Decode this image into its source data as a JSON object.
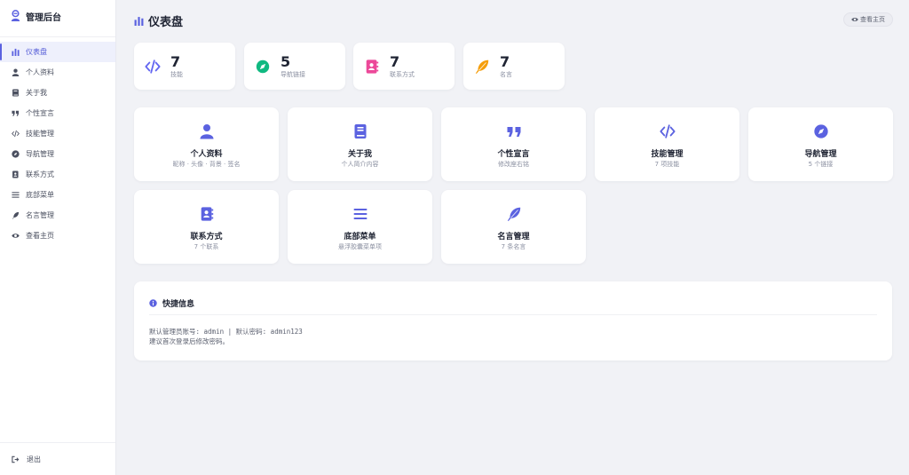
{
  "brand": {
    "title": "管理后台"
  },
  "sidebar": {
    "items": [
      {
        "label": "仪表盘",
        "icon": "chart-bar-icon",
        "active": true
      },
      {
        "label": "个人资料",
        "icon": "user-icon"
      },
      {
        "label": "关于我",
        "icon": "book-icon"
      },
      {
        "label": "个性宣言",
        "icon": "quote-icon"
      },
      {
        "label": "技能管理",
        "icon": "code-icon"
      },
      {
        "label": "导航管理",
        "icon": "compass-icon"
      },
      {
        "label": "联系方式",
        "icon": "address-book-icon"
      },
      {
        "label": "底部菜单",
        "icon": "bars-icon"
      },
      {
        "label": "名言管理",
        "icon": "feather-icon"
      },
      {
        "label": "查看主页",
        "icon": "eye-icon"
      }
    ],
    "logout_label": "退出"
  },
  "header": {
    "title": "仪表盘",
    "view_home_label": "查看主页"
  },
  "stats": [
    {
      "value": "7",
      "label": "技能",
      "icon": "code-icon",
      "color": "#6366f1"
    },
    {
      "value": "5",
      "label": "导航链接",
      "icon": "compass-icon",
      "color": "#10b981"
    },
    {
      "value": "7",
      "label": "联系方式",
      "icon": "address-book-icon",
      "color": "#ec4899"
    },
    {
      "value": "7",
      "label": "名言",
      "icon": "feather-icon",
      "color": "#f59e0b"
    }
  ],
  "features": [
    {
      "title": "个人资料",
      "subtitle": "昵称 · 头像 · 背景 · 签名",
      "icon": "user-icon"
    },
    {
      "title": "关于我",
      "subtitle": "个人简介内容",
      "icon": "book-icon"
    },
    {
      "title": "个性宣言",
      "subtitle": "修改座右铭",
      "icon": "quote-icon"
    },
    {
      "title": "技能管理",
      "subtitle": "7 项技能",
      "icon": "code-icon"
    },
    {
      "title": "导航管理",
      "subtitle": "5 个链接",
      "icon": "compass-icon"
    },
    {
      "title": "联系方式",
      "subtitle": "7 个联系",
      "icon": "address-book-icon"
    },
    {
      "title": "底部菜单",
      "subtitle": "悬浮胶囊菜单项",
      "icon": "bars-icon"
    },
    {
      "title": "名言管理",
      "subtitle": "7 条名言",
      "icon": "feather-icon"
    }
  ],
  "quick_info": {
    "title": "快捷信息",
    "line1": "默认管理员账号: admin | 默认密码: admin123",
    "line2": "建议首次登录后修改密码。"
  },
  "colors": {
    "accent": "#5b62e0",
    "background": "#f1f2f6"
  }
}
